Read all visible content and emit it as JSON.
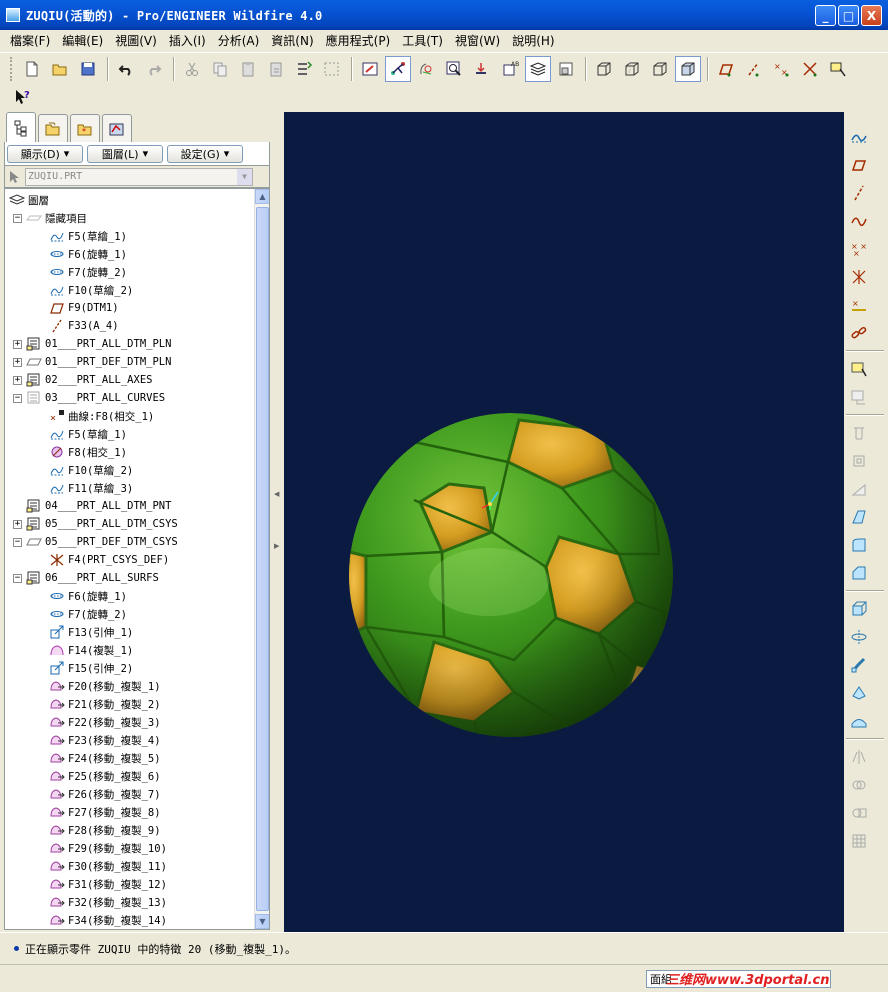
{
  "window": {
    "title": "ZUQIU(活動的) - Pro/ENGINEER Wildfire 4.0",
    "controls": [
      "_",
      "□",
      "X"
    ]
  },
  "menu": [
    "檔案(F)",
    "編輯(E)",
    "視圖(V)",
    "插入(I)",
    "分析(A)",
    "資訊(N)",
    "應用程式(P)",
    "工具(T)",
    "視窗(W)",
    "說明(H)"
  ],
  "toolbar_icons": [
    "new-icon",
    "open-icon",
    "save-icon",
    "undo-icon",
    "redo-icon",
    "cut-icon",
    "copy-icon",
    "paste-icon",
    "paste-special-icon",
    "regenerate-icon",
    "select-box-icon",
    "repaint-icon",
    "spin-center-icon",
    "orient-mode-icon",
    "zoom-in-icon",
    "refit-icon",
    "named-view-icon",
    "layers-icon",
    "view-manager-icon",
    "wireframe-icon",
    "hidden-line-icon",
    "no-hidden-icon",
    "shading-icon",
    "datum-planes-icon",
    "datum-axes-icon",
    "datum-points-icon",
    "coordinate-systems-icon",
    "annotation-display-icon",
    "whats-this-icon"
  ],
  "left_panel": {
    "tabs": [
      "model-tree-tab",
      "folder-browser-tab",
      "favorites-tab",
      "connections-tab"
    ],
    "buttons": [
      "顯示(D)",
      "圖層(L)",
      "設定(G)"
    ],
    "model_name": "ZUQIU.PRT",
    "tree": [
      {
        "level": 0,
        "expander": "",
        "icon": "layers",
        "label": "圖層"
      },
      {
        "level": 1,
        "expander": "-",
        "icon": "hidden-layer",
        "label": "隱藏項目"
      },
      {
        "level": 2,
        "expander": "",
        "icon": "sketch",
        "label": "F5(草繪_1)"
      },
      {
        "level": 2,
        "expander": "",
        "icon": "revolve",
        "label": "F6(旋轉_1)"
      },
      {
        "level": 2,
        "expander": "",
        "icon": "revolve",
        "label": "F7(旋轉_2)"
      },
      {
        "level": 2,
        "expander": "",
        "icon": "sketch",
        "label": "F10(草繪_2)"
      },
      {
        "level": 2,
        "expander": "",
        "icon": "datum-plane",
        "label": "F9(DTM1)"
      },
      {
        "level": 2,
        "expander": "",
        "icon": "axis",
        "label": "F33(A_4)"
      },
      {
        "level": 1,
        "expander": "+",
        "icon": "layer",
        "label": "01___PRT_ALL_DTM_PLN"
      },
      {
        "level": 1,
        "expander": "+",
        "icon": "layer-def",
        "label": "01___PRT_DEF_DTM_PLN"
      },
      {
        "level": 1,
        "expander": "+",
        "icon": "layer",
        "label": "02___PRT_ALL_AXES"
      },
      {
        "level": 1,
        "expander": "-",
        "icon": "layer-hidden",
        "label": "03___PRT_ALL_CURVES"
      },
      {
        "level": 2,
        "expander": "",
        "icon": "curve",
        "label": "曲線:F8(相交_1)"
      },
      {
        "level": 2,
        "expander": "",
        "icon": "sketch",
        "label": "F5(草繪_1)"
      },
      {
        "level": 2,
        "expander": "",
        "icon": "intersect",
        "label": "F8(相交_1)"
      },
      {
        "level": 2,
        "expander": "",
        "icon": "sketch",
        "label": "F10(草繪_2)"
      },
      {
        "level": 2,
        "expander": "",
        "icon": "sketch",
        "label": "F11(草繪_3)"
      },
      {
        "level": 1,
        "expander": "",
        "icon": "layer",
        "label": "04___PRT_ALL_DTM_PNT"
      },
      {
        "level": 1,
        "expander": "+",
        "icon": "layer",
        "label": "05___PRT_ALL_DTM_CSYS"
      },
      {
        "level": 1,
        "expander": "-",
        "icon": "layer-def",
        "label": "05___PRT_DEF_DTM_CSYS"
      },
      {
        "level": 2,
        "expander": "",
        "icon": "csys",
        "label": "F4(PRT_CSYS_DEF)"
      },
      {
        "level": 1,
        "expander": "-",
        "icon": "layer",
        "label": "06___PRT_ALL_SURFS"
      },
      {
        "level": 2,
        "expander": "",
        "icon": "revolve",
        "label": "F6(旋轉_1)"
      },
      {
        "level": 2,
        "expander": "",
        "icon": "revolve",
        "label": "F7(旋轉_2)"
      },
      {
        "level": 2,
        "expander": "",
        "icon": "extrude",
        "label": "F13(引伸_1)"
      },
      {
        "level": 2,
        "expander": "",
        "icon": "copy",
        "label": "F14(複製_1)"
      },
      {
        "level": 2,
        "expander": "",
        "icon": "extrude",
        "label": "F15(引伸_2)"
      },
      {
        "level": 2,
        "expander": "",
        "icon": "move-copy",
        "label": "F20(移動_複製_1)"
      },
      {
        "level": 2,
        "expander": "",
        "icon": "move-copy",
        "label": "F21(移動_複製_2)"
      },
      {
        "level": 2,
        "expander": "",
        "icon": "move-copy",
        "label": "F22(移動_複製_3)"
      },
      {
        "level": 2,
        "expander": "",
        "icon": "move-copy",
        "label": "F23(移動_複製_4)"
      },
      {
        "level": 2,
        "expander": "",
        "icon": "move-copy",
        "label": "F24(移動_複製_5)"
      },
      {
        "level": 2,
        "expander": "",
        "icon": "move-copy",
        "label": "F25(移動_複製_6)"
      },
      {
        "level": 2,
        "expander": "",
        "icon": "move-copy",
        "label": "F26(移動_複製_7)"
      },
      {
        "level": 2,
        "expander": "",
        "icon": "move-copy",
        "label": "F27(移動_複製_8)"
      },
      {
        "level": 2,
        "expander": "",
        "icon": "move-copy",
        "label": "F28(移動_複製_9)"
      },
      {
        "level": 2,
        "expander": "",
        "icon": "move-copy",
        "label": "F29(移動_複製_10)"
      },
      {
        "level": 2,
        "expander": "",
        "icon": "move-copy",
        "label": "F30(移動_複製_11)"
      },
      {
        "level": 2,
        "expander": "",
        "icon": "move-copy",
        "label": "F31(移動_複製_12)"
      },
      {
        "level": 2,
        "expander": "",
        "icon": "move-copy",
        "label": "F32(移動_複製_13)"
      },
      {
        "level": 2,
        "expander": "",
        "icon": "move-copy",
        "label": "F34(移動_複製_14)"
      }
    ]
  },
  "graphics": {
    "background": "#0b1a40",
    "ball_green": "#3a8d1c",
    "ball_gold": "#d8a227"
  },
  "right_toolbar_icons": [
    "sketched-curve-icon",
    "datum-plane-tool-icon",
    "datum-axis-tool-icon",
    "datum-curve-tool-icon",
    "datum-point-tool-icon",
    "csys-tool-icon",
    "analysis-tool-icon",
    "chain-icon",
    "sketch-tool-icon",
    "sketch-view-icon",
    "hole-icon",
    "shell-icon",
    "rib-icon",
    "draft-icon",
    "round-icon",
    "chamfer-icon",
    "extrude-tool-icon",
    "revolve-tool-icon",
    "sweep-icon",
    "blend-icon",
    "boundary-icon",
    "mirror-icon",
    "merge-icon",
    "trim-icon",
    "pattern-icon"
  ],
  "status": {
    "message": "正在顯示零件 ZUQIU 中的特徵 20 (移動_複製_1)。",
    "filter_text": "面組",
    "watermark": "三维网www.3dportal.cn"
  }
}
